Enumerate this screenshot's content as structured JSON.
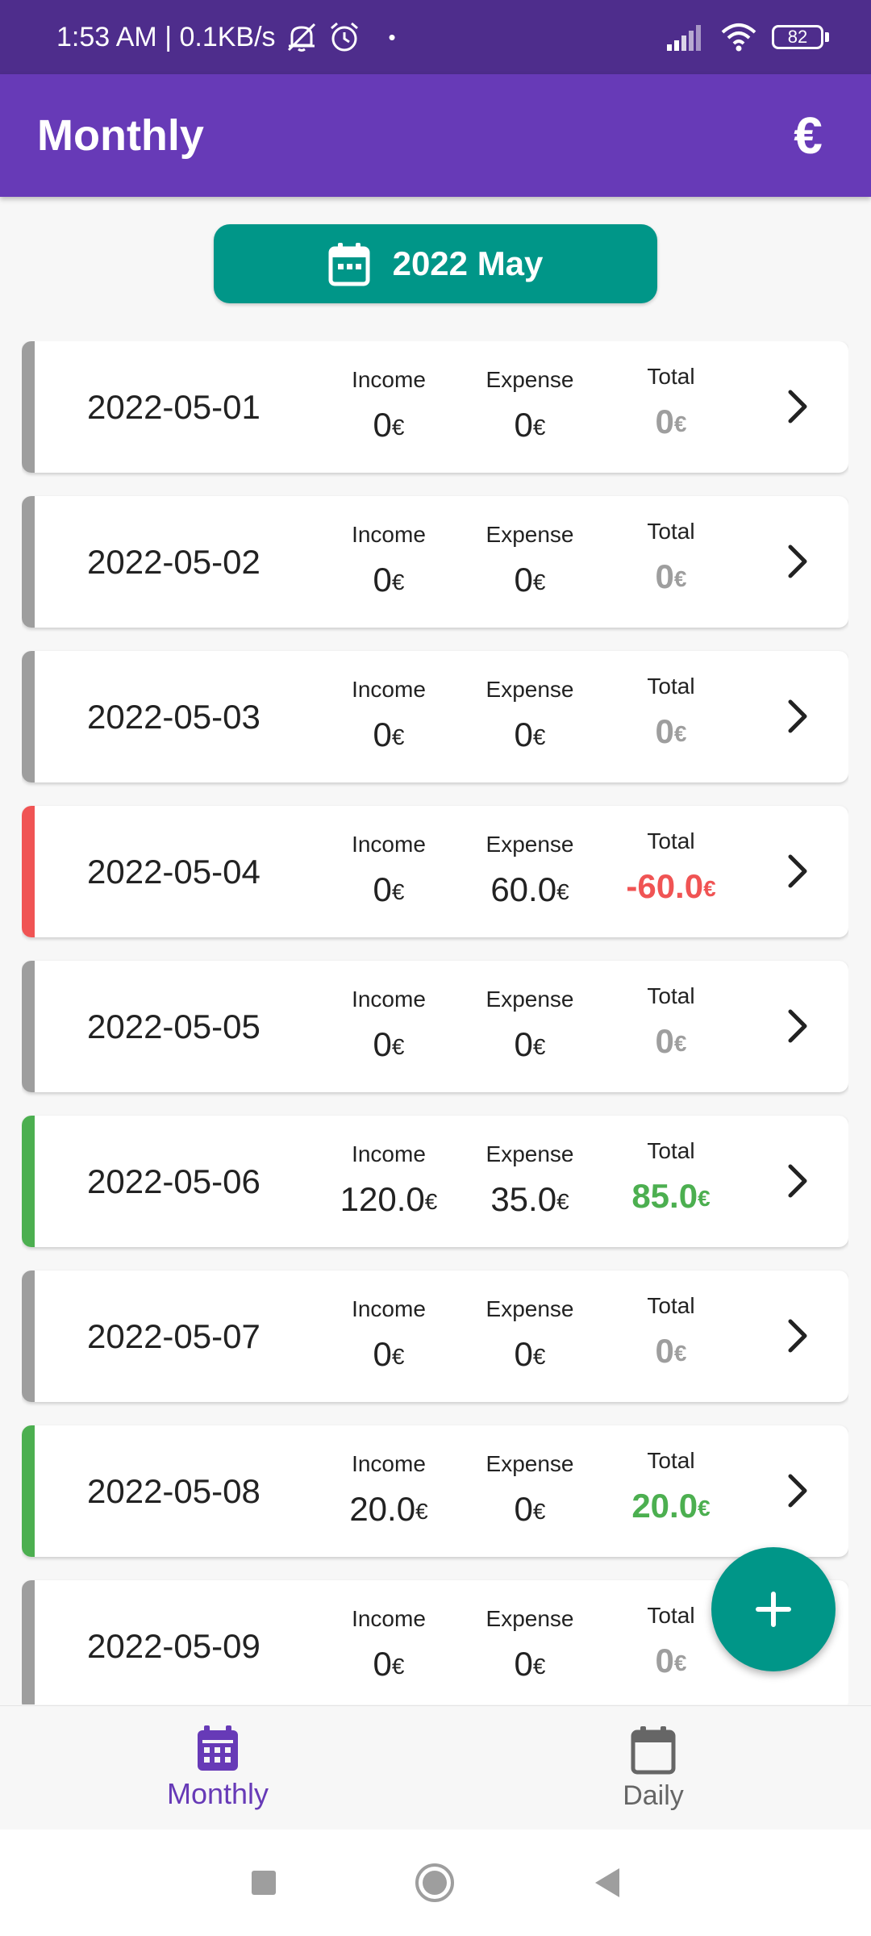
{
  "status_bar": {
    "time_and_speed": "1:53 AM | 0.1KB/s",
    "dot": "•",
    "battery_level": "82"
  },
  "app_bar": {
    "title": "Monthly",
    "currency_symbol": "€"
  },
  "month_selector": {
    "label": "2022 May"
  },
  "labels": {
    "income": "Income",
    "expense": "Expense",
    "total": "Total",
    "currency": "€"
  },
  "colors": {
    "neutral": "#9e9e9e",
    "negative": "#f05454",
    "positive": "#4caf50",
    "app_bar": "#673ab7",
    "accent": "#009688"
  },
  "days": [
    {
      "date": "2022-05-01",
      "income": "0",
      "expense": "0",
      "total": "0",
      "status": "neutral"
    },
    {
      "date": "2022-05-02",
      "income": "0",
      "expense": "0",
      "total": "0",
      "status": "neutral"
    },
    {
      "date": "2022-05-03",
      "income": "0",
      "expense": "0",
      "total": "0",
      "status": "neutral"
    },
    {
      "date": "2022-05-04",
      "income": "0",
      "expense": "60.0",
      "total": "-60.0",
      "status": "negative"
    },
    {
      "date": "2022-05-05",
      "income": "0",
      "expense": "0",
      "total": "0",
      "status": "neutral"
    },
    {
      "date": "2022-05-06",
      "income": "120.0",
      "expense": "35.0",
      "total": "85.0",
      "status": "positive"
    },
    {
      "date": "2022-05-07",
      "income": "0",
      "expense": "0",
      "total": "0",
      "status": "neutral"
    },
    {
      "date": "2022-05-08",
      "income": "20.0",
      "expense": "0",
      "total": "20.0",
      "status": "positive"
    },
    {
      "date": "2022-05-09",
      "income": "0",
      "expense": "0",
      "total": "0",
      "status": "neutral"
    }
  ],
  "bottom_nav": {
    "monthly_label": "Monthly",
    "daily_label": "Daily"
  },
  "icons": {
    "calendar": "calendar-icon",
    "chevron": "chevron-right-icon",
    "add": "plus-icon",
    "monthly_nav": "calendar-grid-icon",
    "daily_nav": "calendar-blank-icon"
  }
}
